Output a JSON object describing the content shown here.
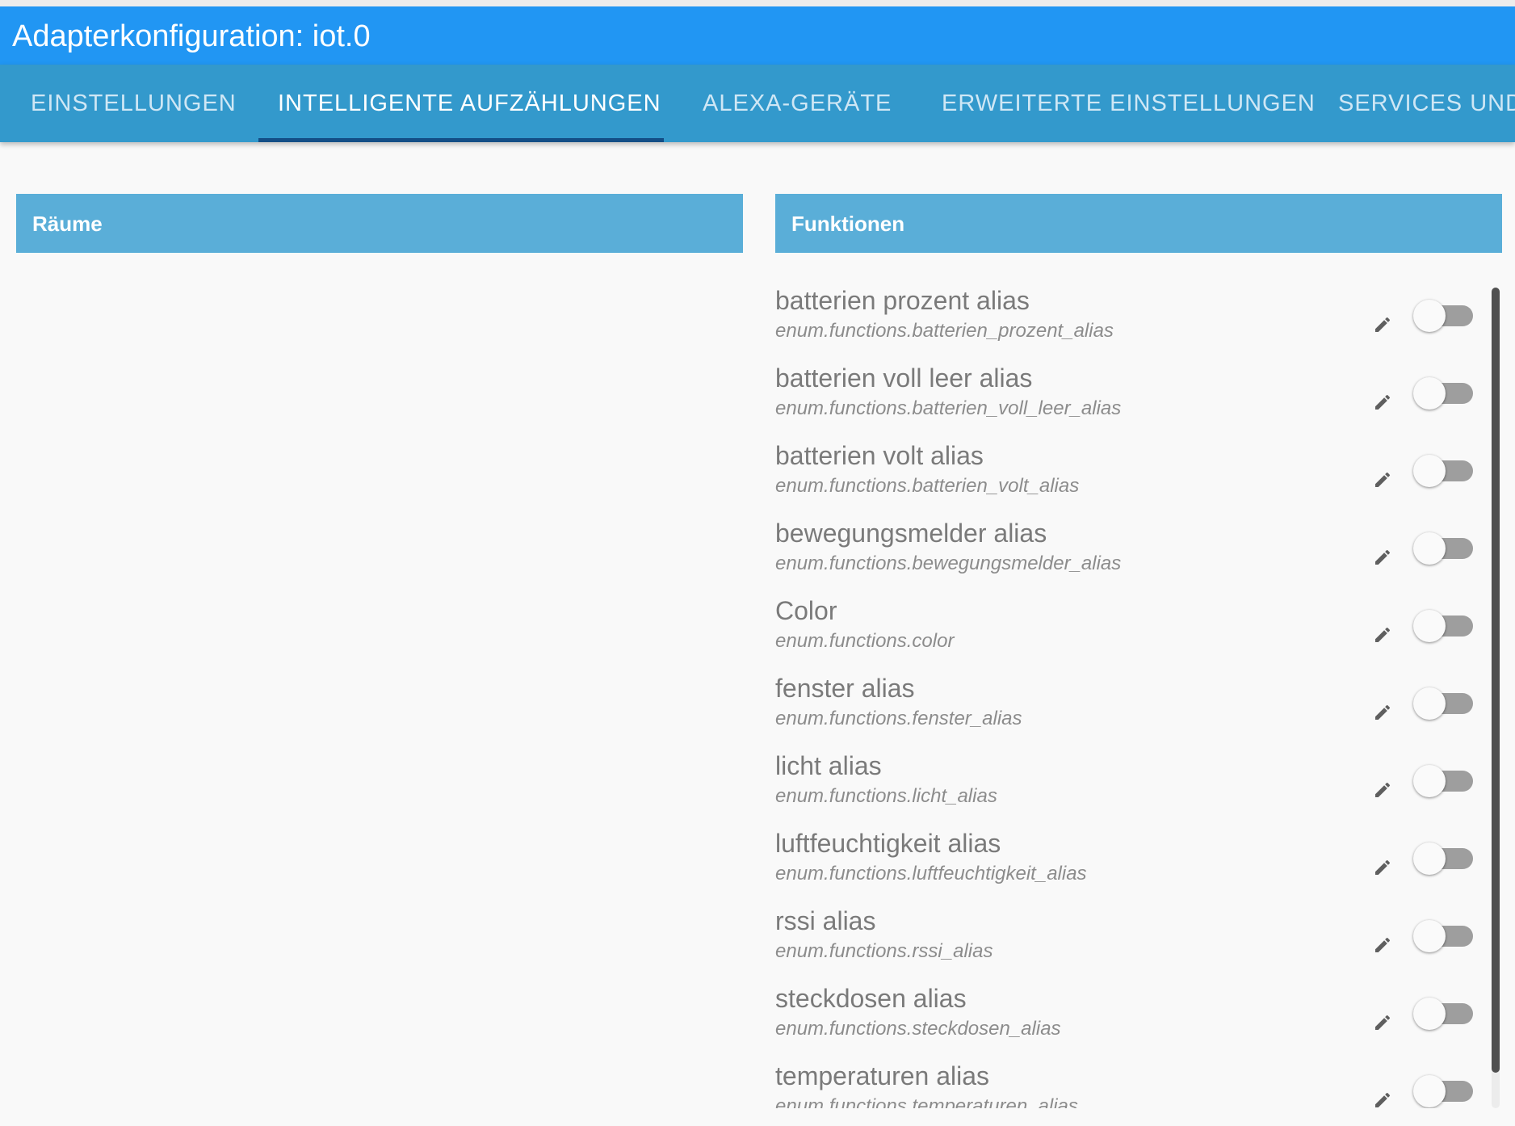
{
  "window": {
    "title": "Adapterkonfiguration: iot.0"
  },
  "tabs": [
    {
      "label": "EINSTELLUNGEN",
      "active": false
    },
    {
      "label": "INTELLIGENTE AUFZÄHLUNGEN",
      "active": true
    },
    {
      "label": "ALEXA-GERÄTE",
      "active": false
    },
    {
      "label": "ERWEITERTE EINSTELLUNGEN",
      "active": false
    },
    {
      "label": "SERVICES UND",
      "active": false
    }
  ],
  "rooms_panel": {
    "header": "Räume"
  },
  "functions_panel": {
    "header": "Funktionen",
    "items": [
      {
        "title": "batterien prozent alias",
        "id": "enum.functions.batterien_prozent_alias",
        "enabled": false
      },
      {
        "title": "batterien voll leer alias",
        "id": "enum.functions.batterien_voll_leer_alias",
        "enabled": false
      },
      {
        "title": "batterien volt alias",
        "id": "enum.functions.batterien_volt_alias",
        "enabled": false
      },
      {
        "title": "bewegungsmelder alias",
        "id": "enum.functions.bewegungsmelder_alias",
        "enabled": false
      },
      {
        "title": "Color",
        "id": "enum.functions.color",
        "enabled": false
      },
      {
        "title": "fenster alias",
        "id": "enum.functions.fenster_alias",
        "enabled": false
      },
      {
        "title": "licht alias",
        "id": "enum.functions.licht_alias",
        "enabled": false
      },
      {
        "title": "luftfeuchtigkeit alias",
        "id": "enum.functions.luftfeuchtigkeit_alias",
        "enabled": false
      },
      {
        "title": "rssi alias",
        "id": "enum.functions.rssi_alias",
        "enabled": false
      },
      {
        "title": "steckdosen alias",
        "id": "enum.functions.steckdosen_alias",
        "enabled": false
      },
      {
        "title": "temperaturen alias",
        "id": "enum.functions.temperaturen_alias",
        "enabled": false
      }
    ]
  },
  "icons": {
    "edit": "pencil-icon"
  },
  "colors": {
    "title_bar": "#2196f3",
    "tab_bar": "#3399cc",
    "tab_indicator": "#134e86",
    "panel_header": "#5aaed8",
    "toggle_track_off": "#9e9e9e"
  }
}
